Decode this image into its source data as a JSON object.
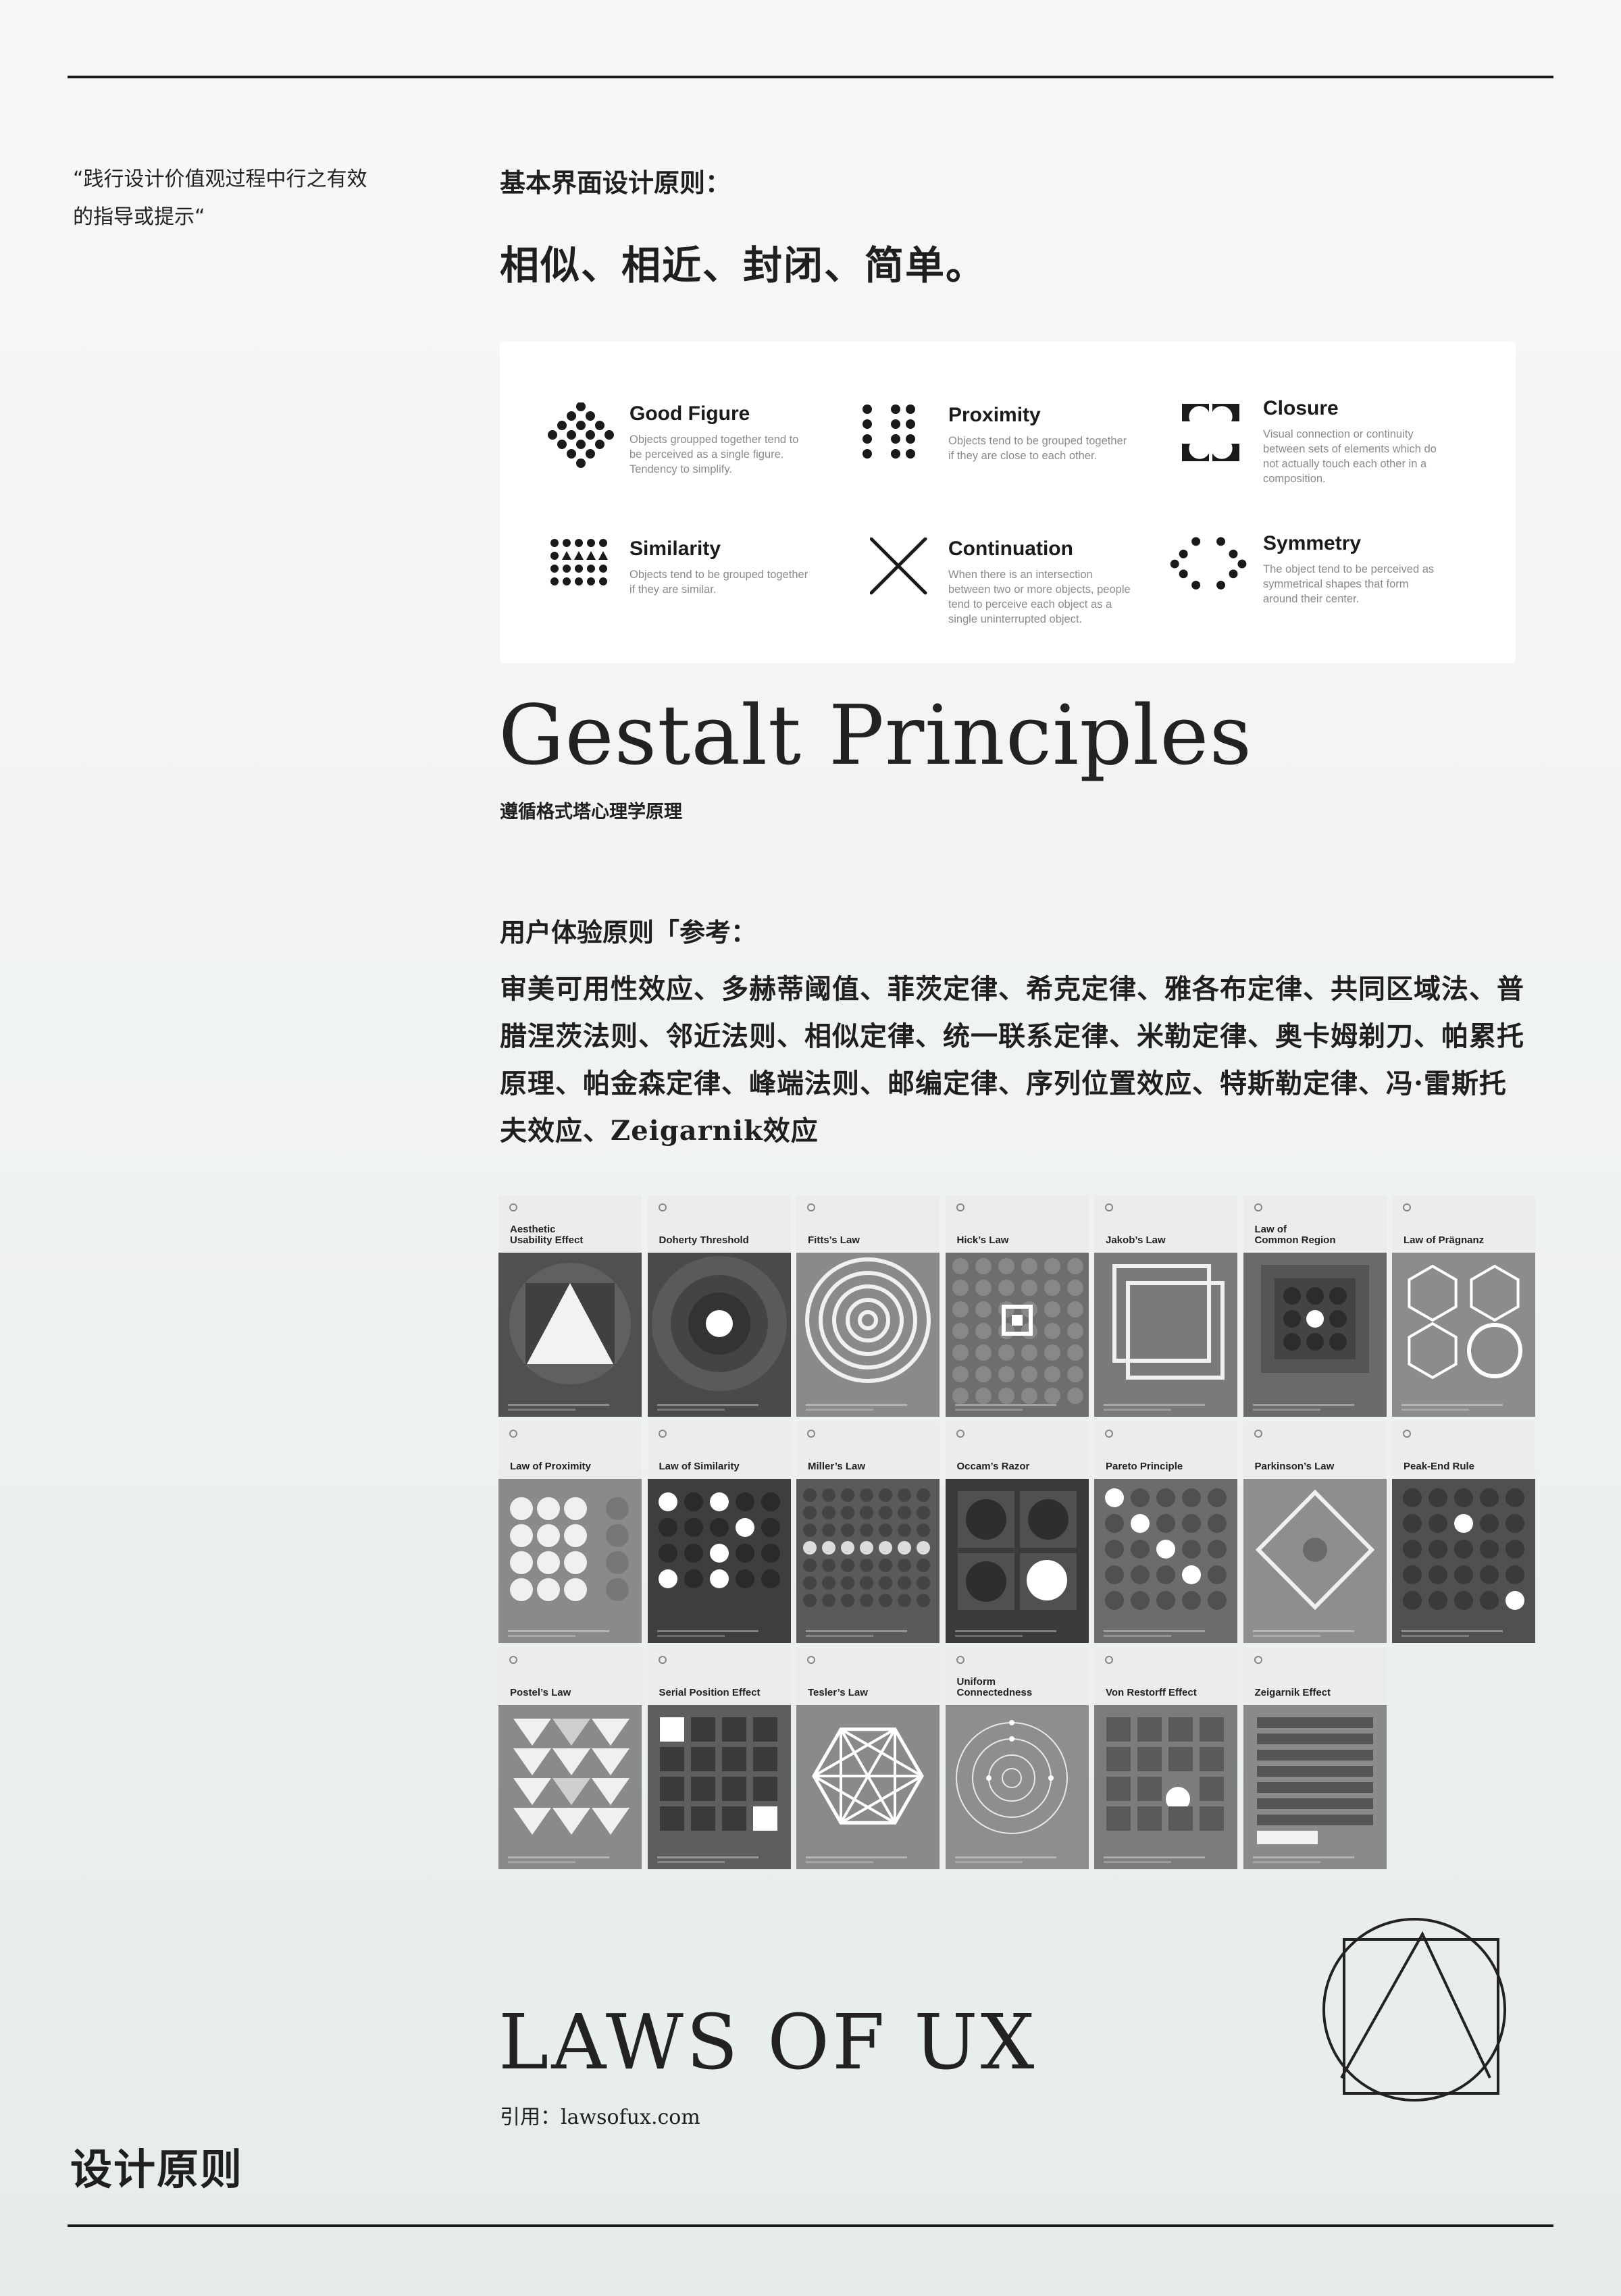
{
  "quote": "“践行设计价值观过程中行之有效的指导或提示“",
  "basic": {
    "heading": "基本界面设计原则：",
    "principles": "相似、相近、封闭、简单。"
  },
  "gestalt_panel": [
    {
      "title": "Good Figure",
      "desc": "Objects groupped together tend to be perceived as a single figure. Tendency to simplify.",
      "icon": "diamond-dots-icon"
    },
    {
      "title": "Proximity",
      "desc": "Objects tend to be grouped together if they are close to each other.",
      "icon": "dot-columns-icon"
    },
    {
      "title": "Closure",
      "desc": "Visual connection or continuity between sets of elements which do not actually touch each other in a composition.",
      "icon": "closure-blob-icon"
    },
    {
      "title": "Similarity",
      "desc": "Objects tend to be grouped together if they are similar.",
      "icon": "dots-triangles-icon"
    },
    {
      "title": "Continuation",
      "desc": "When there is an intersection between two or more objects, people tend to perceive each object as a single uninterrupted object.",
      "icon": "cross-lines-icon"
    },
    {
      "title": "Symmetry",
      "desc": "The object tend to be perceived as symmetrical shapes that form around their center.",
      "icon": "dot-ring-icon"
    }
  ],
  "gestalt": {
    "title": "Gestalt Principles",
    "subtitle": "遵循格式塔心理学原理"
  },
  "ux": {
    "heading": "用户体验原则「参考：",
    "list": "审美可用性效应、多赫蒂阈值、菲茨定律、希克定律、雅各布定律、共同区域法、普腊涅茨法则、邻近法则、相似定律、统一联系定律、米勒定律、奥卡姆剃刀、帕累托原理、帕金森定律、峰端法则、邮编定律、序列位置效应、特斯勒定律、冯·雷斯托夫效应、Zeigarnik效应"
  },
  "cards": [
    {
      "title": "Aesthetic\nUsability Effect"
    },
    {
      "title": "Doherty Threshold"
    },
    {
      "title": "Fitts’s Law"
    },
    {
      "title": "Hick’s Law"
    },
    {
      "title": "Jakob’s Law"
    },
    {
      "title": "Law of\nCommon Region"
    },
    {
      "title": "Law of Prägnanz"
    },
    {
      "title": "Law of Proximity"
    },
    {
      "title": "Law of Similarity"
    },
    {
      "title": "Miller’s Law"
    },
    {
      "title": "Occam’s Razor"
    },
    {
      "title": "Pareto Principle"
    },
    {
      "title": "Parkinson’s Law"
    },
    {
      "title": "Peak-End Rule"
    },
    {
      "title": "Postel’s Law"
    },
    {
      "title": "Serial Position Effect"
    },
    {
      "title": "Tesler’s Law"
    },
    {
      "title": "Uniform\nConnectedness"
    },
    {
      "title": "Von Restorff Effect"
    },
    {
      "title": "Zeigarnik Effect"
    }
  ],
  "laws": {
    "title": "LAWS OF UX",
    "ref": "引用：lawsofux.com"
  },
  "footer_title": "设计原则"
}
